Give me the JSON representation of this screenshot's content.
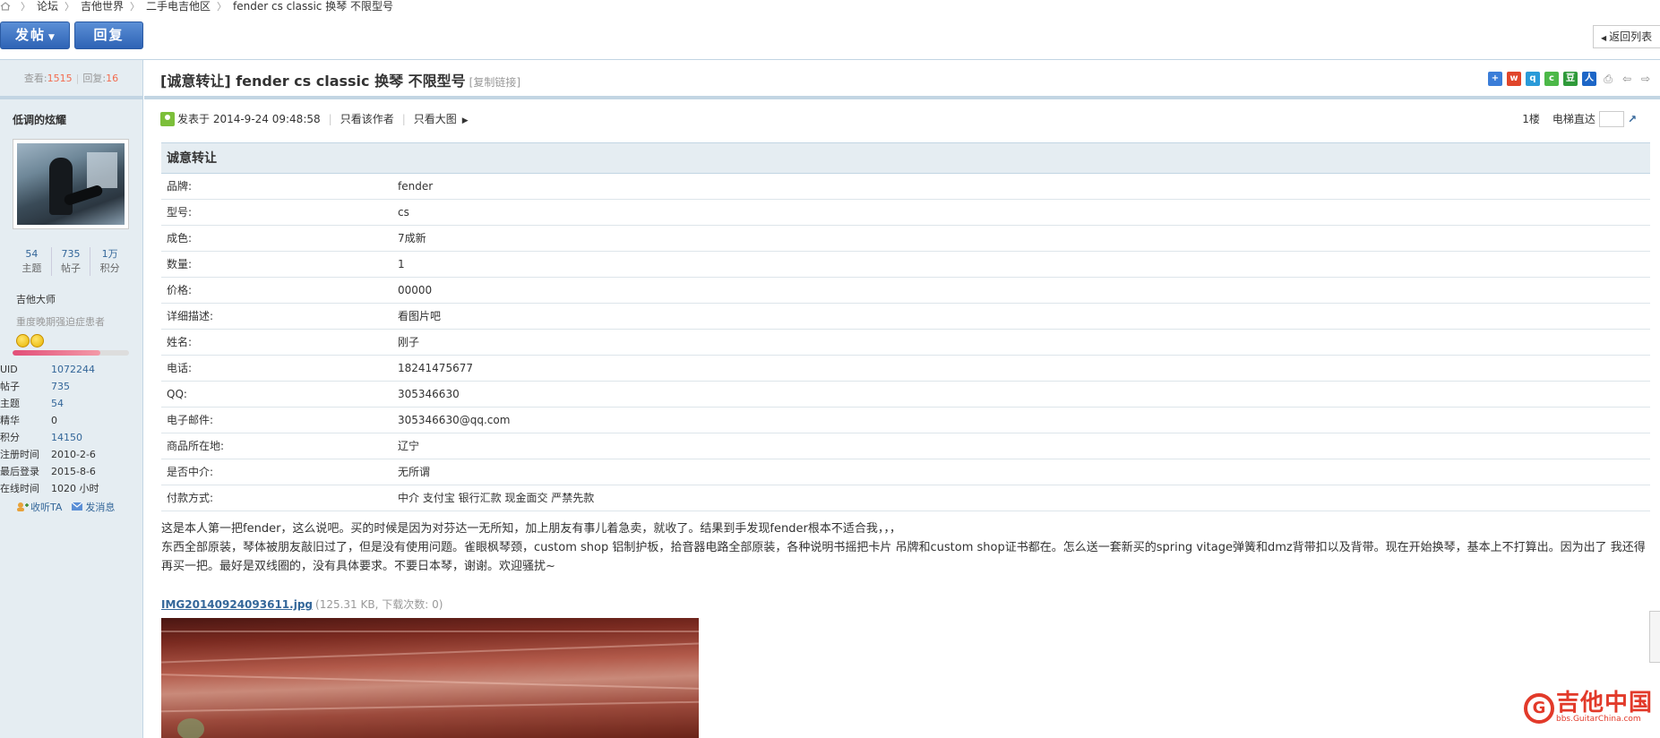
{
  "breadcrumb": [
    "论坛",
    "吉他世界",
    "二手电吉他区",
    "fender cs classic 换琴 不限型号"
  ],
  "toolbar": {
    "post_label": "发帖",
    "reply_label": "回复",
    "back_list_label": "返回列表"
  },
  "stats": {
    "views_label": "查看:",
    "views": "1515",
    "replies_label": "回复:",
    "replies": "16"
  },
  "thread": {
    "title": "[诚意转让] fender cs classic 换琴 不限型号",
    "copy_link": "[复制链接]"
  },
  "author": {
    "name": "低调的炫耀",
    "counters": [
      {
        "value": "54",
        "label": "主题"
      },
      {
        "value": "735",
        "label": "帖子"
      },
      {
        "value": "1万",
        "label": "积分"
      }
    ],
    "rank": "吉他大师",
    "rank_title": "重度晚期强迫症患者",
    "credit_progress": 0.75,
    "info": [
      {
        "key": "UID",
        "value": "1072244"
      },
      {
        "key": "帖子",
        "value": "735"
      },
      {
        "key": "主题",
        "value": "54"
      },
      {
        "key": "精华",
        "value": "0"
      },
      {
        "key": "积分",
        "value": "14150"
      },
      {
        "key": "注册时间",
        "value": "2010-2-6"
      },
      {
        "key": "最后登录",
        "value": "2015-8-6"
      },
      {
        "key": "在线时间",
        "value": "1020 小时"
      }
    ],
    "listen_label": "收听TA",
    "message_label": "发消息"
  },
  "post": {
    "posted_at": "发表于 2014-9-24 09:48:58",
    "only_author": "只看该作者",
    "big_image": "只看大图",
    "floor": "1楼",
    "elevator": "电梯直达"
  },
  "trade": {
    "title": "诚意转让",
    "rows": [
      {
        "k": "品牌:",
        "v": "fender"
      },
      {
        "k": "型号:",
        "v": "cs"
      },
      {
        "k": "成色:",
        "v": "7成新"
      },
      {
        "k": "数量:",
        "v": "1"
      },
      {
        "k": "价格:",
        "v": "00000"
      },
      {
        "k": "详细描述:",
        "v": "看图片吧"
      },
      {
        "k": "姓名:",
        "v": "刚子"
      },
      {
        "k": "电话:",
        "v": "18241475677"
      },
      {
        "k": "QQ:",
        "v": "305346630"
      },
      {
        "k": "电子邮件:",
        "v": "305346630@qq.com"
      },
      {
        "k": "商品所在地:",
        "v": "辽宁"
      },
      {
        "k": "是否中介:",
        "v": "无所谓"
      },
      {
        "k": "付款方式:",
        "v": "中介 支付宝 银行汇款 现金面交 严禁先款"
      }
    ]
  },
  "message": {
    "line1": "这是本人第一把fender，这么说吧。买的时候是因为对芬达一无所知，加上朋友有事儿着急卖，就收了。结果到手发现fender根本不适合我，，，",
    "line2": "东西全部原装，琴体被朋友敲旧过了，但是没有使用问题。雀眼枫琴颈，custom shop 铝制护板，拾音器电路全部原装，各种说明书摇把卡片 吊牌和custom shop证书都在。怎么送一套新买的spring vitage弹簧和dmz背带扣以及背带。现在开始换琴，基本上不打算出。因为出了 我还得再买一把。最好是双线圈的，没有具体要求。不要日本琴，谢谢。欢迎骚扰~"
  },
  "attachment": {
    "name": "IMG20140924093611.jpg",
    "info": "(125.31 KB, 下载次数: 0)"
  },
  "watermark": {
    "main": "吉他中国",
    "sub": "bbs.GuitarChina.com"
  },
  "colors": {
    "accent": "#336699",
    "highlight": "#f26c4f",
    "panel": "#e5edf2",
    "border": "#c2d5e3"
  }
}
